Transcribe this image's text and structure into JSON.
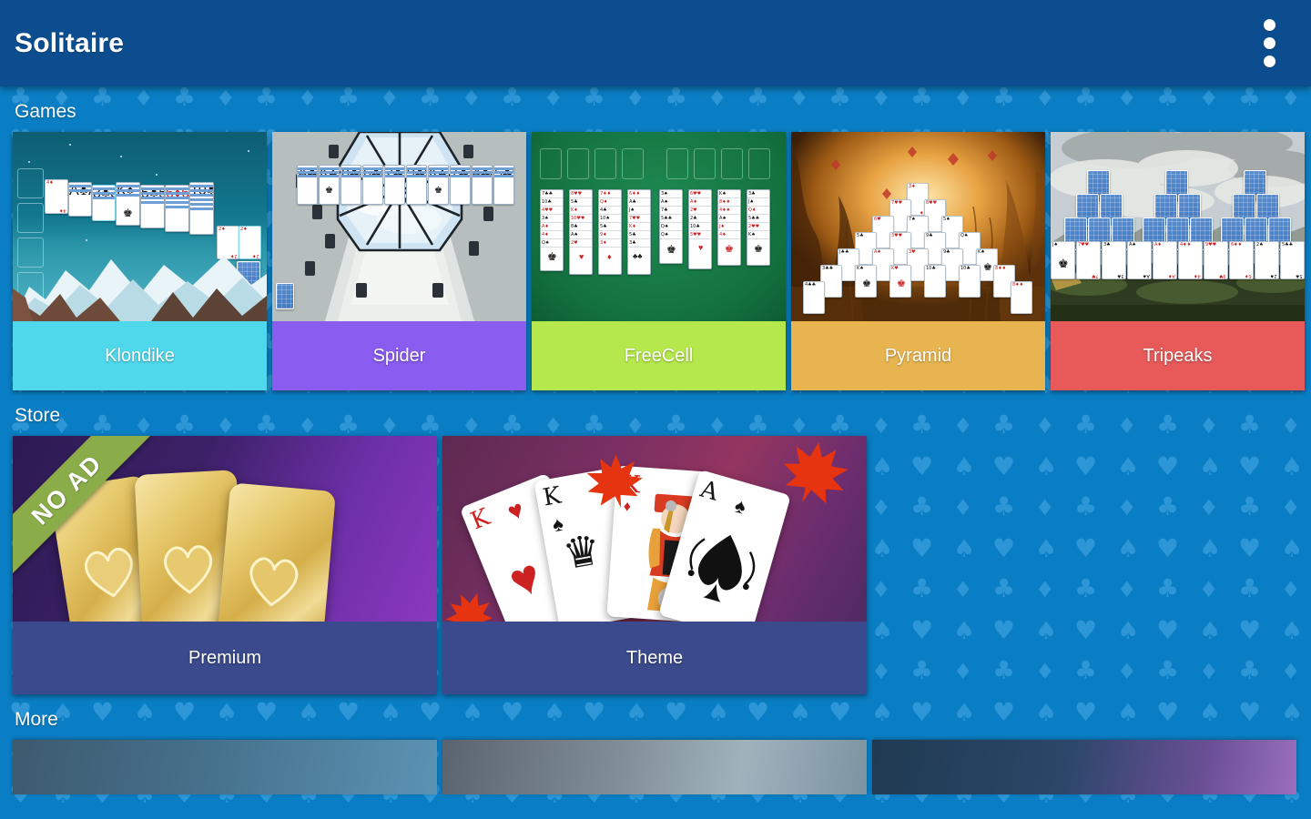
{
  "appbar": {
    "title": "Solitaire",
    "overflow_menu_icon": "three-dots-vertical-icon"
  },
  "sections": {
    "games": {
      "title": "Games"
    },
    "store": {
      "title": "Store"
    },
    "more": {
      "title": "More"
    }
  },
  "games": [
    {
      "label": "Klondike",
      "label_color": "#4fd8ec",
      "art": "snowy-mountain-night"
    },
    {
      "label": "Spider",
      "label_color": "#8a5cf0",
      "art": "skylight-atrium-ceiling"
    },
    {
      "label": "FreeCell",
      "label_color": "#b5e84c",
      "art": "green-felt-table"
    },
    {
      "label": "Pyramid",
      "label_color": "#e8b44f",
      "art": "autumn-golden-forest"
    },
    {
      "label": "Tripeaks",
      "label_color": "#e85a5a",
      "art": "cloudy-sky-landscape"
    }
  ],
  "store": [
    {
      "label": "Premium",
      "badge": "NO AD",
      "badge_color": "#8aad4a",
      "label_color": "#3a4a8c",
      "art": "three-gold-heart-cards"
    },
    {
      "label": "Theme",
      "badge": null,
      "badge_color": null,
      "label_color": "#3a4a8c",
      "art": "fanned-cards-maple-leaves"
    }
  ],
  "theme_cards": [
    {
      "rank": "K",
      "suit": "♥",
      "color": "#cc2222"
    },
    {
      "rank": "K",
      "suit": "♠",
      "color": "#151515"
    },
    {
      "rank": "K",
      "suit": "♦",
      "color": "#cc2222"
    },
    {
      "rank": "A",
      "suit": "♠",
      "color": "#151515"
    }
  ],
  "colors": {
    "appbar": "#0b4d8f",
    "background": "#0a7ec4",
    "pattern": "#2a94d4",
    "store_label": "#3a4a8c"
  },
  "background_pattern": {
    "suits": [
      "♣",
      "♦",
      "♥",
      "♠"
    ]
  }
}
